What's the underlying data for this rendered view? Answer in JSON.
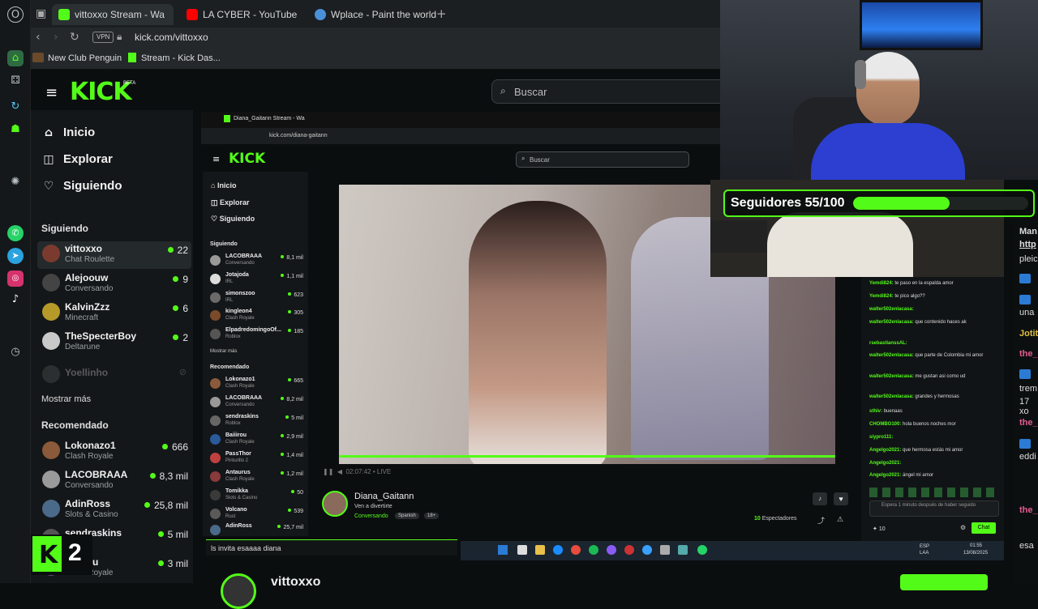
{
  "browser": {
    "tabs": [
      {
        "label": "vittoxxo Stream - Wa",
        "active": true,
        "favicon_color": "#53fc18"
      },
      {
        "label": "LA CYBER - YouTube",
        "active": false,
        "favicon_color": "#ff0000"
      },
      {
        "label": "Wplace - Paint the world",
        "active": false,
        "favicon_color": "#4a90d9"
      }
    ],
    "new_tab": "+",
    "vpn_label": "VPN",
    "url": "kick.com/vittoxxo",
    "bookmarks": [
      {
        "label": "New Club Penguin"
      },
      {
        "label": "Stream - Kick Das..."
      }
    ]
  },
  "kick": {
    "logo": "KICK",
    "logo_badge": "BETA",
    "search_placeholder": "Buscar",
    "nav": [
      {
        "label": "Inicio",
        "icon": "home-icon"
      },
      {
        "label": "Explorar",
        "icon": "compass-icon"
      },
      {
        "label": "Siguiendo",
        "icon": "heart-icon"
      }
    ],
    "following_title": "Siguiendo",
    "following": [
      {
        "name": "vittoxxo",
        "category": "Chat Roulette",
        "viewers": "22",
        "avatar_color": "#7a3b2e"
      },
      {
        "name": "Alejoouw",
        "category": "Conversando",
        "viewers": "9",
        "avatar_color": "#444"
      },
      {
        "name": "KalvinZzz",
        "category": "Minecraft",
        "viewers": "6",
        "avatar_color": "#b59a2a"
      },
      {
        "name": "TheSpecterBoy",
        "category": "Deltarune",
        "viewers": "2",
        "avatar_color": "#c9c9c9"
      }
    ],
    "offline": {
      "name": "Yoellinho"
    },
    "show_more": "Mostrar más",
    "recommended_title": "Recomendado",
    "recommended": [
      {
        "name": "Lokonazo1",
        "category": "Clash Royale",
        "viewers": "666",
        "avatar_color": "#8a5a3a"
      },
      {
        "name": "LACOBRAAA",
        "category": "Conversando",
        "viewers": "8,3 mil",
        "avatar_color": "#9a9a9a"
      },
      {
        "name": "AdinRoss",
        "category": "Slots & Casino",
        "viewers": "25,8 mil",
        "avatar_color": "#4b6a8a"
      },
      {
        "name": "sendraskins",
        "category": "",
        "viewers": "5 mil",
        "avatar_color": "#555"
      },
      {
        "name": "Baiirou",
        "category": "Clash Royale",
        "viewers": "3 mil",
        "avatar_color": "#6a4a8a"
      }
    ],
    "channel_bottom": "vittoxxo",
    "badge_number": "2"
  },
  "inner": {
    "tab_label": "Diana_Gaitann Stream - Wa",
    "url": "kick.com/diana-gaitann",
    "logo": "KICK",
    "search_placeholder": "Buscar",
    "nav": [
      "Inicio",
      "Explorar",
      "Siguiendo"
    ],
    "following_title": "Siguiendo",
    "following": [
      {
        "name": "LACOBRAAA",
        "category": "Conversando",
        "viewers": "8,1 mil"
      },
      {
        "name": "Jotajoda",
        "category": "IRL",
        "viewers": "1,1 mil"
      },
      {
        "name": "simonszoo",
        "category": "IRL",
        "viewers": "623"
      },
      {
        "name": "kingleon4",
        "category": "Clash Royale",
        "viewers": "305"
      },
      {
        "name": "ElpadredomingoOf...",
        "category": "Roblox",
        "viewers": "185"
      }
    ],
    "show_more": "Mostrar más",
    "recommended_title": "Recomendado",
    "recommended": [
      {
        "name": "Lokonazo1",
        "category": "Clash Royale",
        "viewers": "665"
      },
      {
        "name": "LACOBRAAA",
        "category": "Conversando",
        "viewers": "8,2 mil"
      },
      {
        "name": "sendraskins",
        "category": "Roblox",
        "viewers": "5 mil"
      },
      {
        "name": "Baiiirou",
        "category": "Clash Royale",
        "viewers": "2,9 mil"
      },
      {
        "name": "PassThor",
        "category": "Pinturillo 2",
        "viewers": "1,4 mil"
      },
      {
        "name": "Antaurus",
        "category": "Clash Royale",
        "viewers": "1,2 mil"
      },
      {
        "name": "Tomikka",
        "category": "Slots & Casino",
        "viewers": "50"
      },
      {
        "name": "Volcano",
        "category": "Rust",
        "viewers": "539"
      },
      {
        "name": "AdinRoss",
        "category": "",
        "viewers": "25,7 mil"
      }
    ],
    "player_time": "02:07:42",
    "player_live": "LIVE",
    "streamer": "Diana_Gaitann",
    "stream_title": "Ven a divertirte",
    "category": "Conversando",
    "tags": [
      "Spanish",
      "18+"
    ],
    "viewers": "10",
    "viewers_label": "Espectadores",
    "chat_notice": "Espera 1 minuto después de haber seguido",
    "chat_button": "Chat",
    "points": "10",
    "chat_messages": [
      {
        "user": "Yemdi824:",
        "text": "te paso en la espalda amor"
      },
      {
        "user": "Yemdi824:",
        "text": "te pico algo??"
      },
      {
        "user": "walter502enlacasa:",
        "text": ""
      },
      {
        "user": "walter502enlacasa:",
        "text": "que contenido haces ak"
      },
      {
        "user": "rsebastianssAL:",
        "text": ""
      },
      {
        "user": "walter502enlacasa:",
        "text": "que parte de Colombia mi amor"
      },
      {
        "user": "walter502enlacasa:",
        "text": "me gustan asi como ud"
      },
      {
        "user": "walter502enlacasa:",
        "text": "grandes y hermosas"
      },
      {
        "user": "sthiv:",
        "text": "buenaas"
      },
      {
        "user": "CHOMBO100:",
        "text": "hola buenos noches mor"
      },
      {
        "user": "siypro111:",
        "text": ""
      },
      {
        "user": "Angelgo2021:",
        "text": "que hermosa estás mi amor"
      },
      {
        "user": "Angelgo2021:",
        "text": ""
      },
      {
        "user": "Angelgo2021:",
        "text": "ángel mi amor"
      }
    ],
    "toast": "ls invita esaaaa diana",
    "tray_lang": "ESP LAA",
    "tray_time": "01:55",
    "tray_date": "13/08/2025"
  },
  "overlay": {
    "followers_label": "Seguidores 55/100",
    "followers_progress": 0.55,
    "accent": "#53fc18"
  },
  "right_strip": {
    "texts": [
      "Man",
      "http",
      "pleic",
      "una",
      "Jotit",
      "the_",
      "trem",
      "17 xo",
      "the_",
      "eddi",
      "the_",
      "esa"
    ]
  }
}
